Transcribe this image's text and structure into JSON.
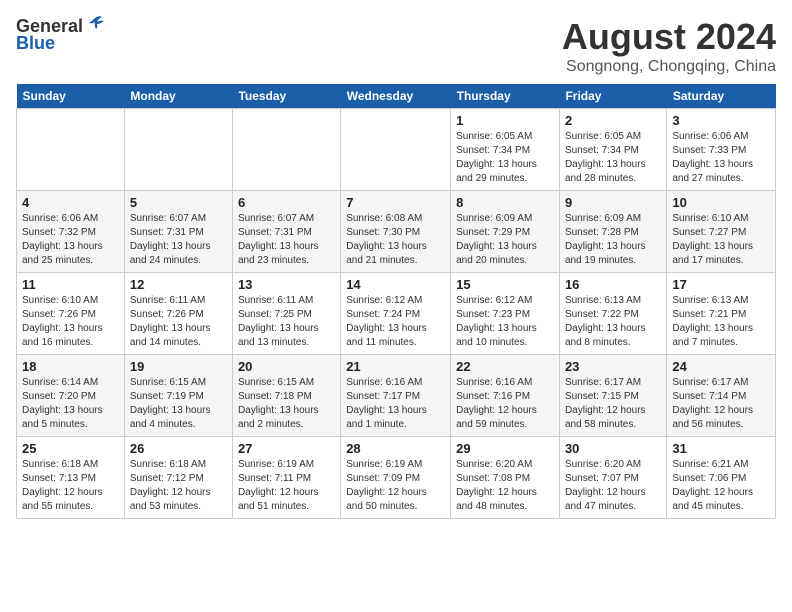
{
  "header": {
    "logo_general": "General",
    "logo_blue": "Blue",
    "month_year": "August 2024",
    "location": "Songnong, Chongqing, China"
  },
  "days_of_week": [
    "Sunday",
    "Monday",
    "Tuesday",
    "Wednesday",
    "Thursday",
    "Friday",
    "Saturday"
  ],
  "weeks": [
    [
      {
        "day": "",
        "info": ""
      },
      {
        "day": "",
        "info": ""
      },
      {
        "day": "",
        "info": ""
      },
      {
        "day": "",
        "info": ""
      },
      {
        "day": "1",
        "info": "Sunrise: 6:05 AM\nSunset: 7:34 PM\nDaylight: 13 hours\nand 29 minutes."
      },
      {
        "day": "2",
        "info": "Sunrise: 6:05 AM\nSunset: 7:34 PM\nDaylight: 13 hours\nand 28 minutes."
      },
      {
        "day": "3",
        "info": "Sunrise: 6:06 AM\nSunset: 7:33 PM\nDaylight: 13 hours\nand 27 minutes."
      }
    ],
    [
      {
        "day": "4",
        "info": "Sunrise: 6:06 AM\nSunset: 7:32 PM\nDaylight: 13 hours\nand 25 minutes."
      },
      {
        "day": "5",
        "info": "Sunrise: 6:07 AM\nSunset: 7:31 PM\nDaylight: 13 hours\nand 24 minutes."
      },
      {
        "day": "6",
        "info": "Sunrise: 6:07 AM\nSunset: 7:31 PM\nDaylight: 13 hours\nand 23 minutes."
      },
      {
        "day": "7",
        "info": "Sunrise: 6:08 AM\nSunset: 7:30 PM\nDaylight: 13 hours\nand 21 minutes."
      },
      {
        "day": "8",
        "info": "Sunrise: 6:09 AM\nSunset: 7:29 PM\nDaylight: 13 hours\nand 20 minutes."
      },
      {
        "day": "9",
        "info": "Sunrise: 6:09 AM\nSunset: 7:28 PM\nDaylight: 13 hours\nand 19 minutes."
      },
      {
        "day": "10",
        "info": "Sunrise: 6:10 AM\nSunset: 7:27 PM\nDaylight: 13 hours\nand 17 minutes."
      }
    ],
    [
      {
        "day": "11",
        "info": "Sunrise: 6:10 AM\nSunset: 7:26 PM\nDaylight: 13 hours\nand 16 minutes."
      },
      {
        "day": "12",
        "info": "Sunrise: 6:11 AM\nSunset: 7:26 PM\nDaylight: 13 hours\nand 14 minutes."
      },
      {
        "day": "13",
        "info": "Sunrise: 6:11 AM\nSunset: 7:25 PM\nDaylight: 13 hours\nand 13 minutes."
      },
      {
        "day": "14",
        "info": "Sunrise: 6:12 AM\nSunset: 7:24 PM\nDaylight: 13 hours\nand 11 minutes."
      },
      {
        "day": "15",
        "info": "Sunrise: 6:12 AM\nSunset: 7:23 PM\nDaylight: 13 hours\nand 10 minutes."
      },
      {
        "day": "16",
        "info": "Sunrise: 6:13 AM\nSunset: 7:22 PM\nDaylight: 13 hours\nand 8 minutes."
      },
      {
        "day": "17",
        "info": "Sunrise: 6:13 AM\nSunset: 7:21 PM\nDaylight: 13 hours\nand 7 minutes."
      }
    ],
    [
      {
        "day": "18",
        "info": "Sunrise: 6:14 AM\nSunset: 7:20 PM\nDaylight: 13 hours\nand 5 minutes."
      },
      {
        "day": "19",
        "info": "Sunrise: 6:15 AM\nSunset: 7:19 PM\nDaylight: 13 hours\nand 4 minutes."
      },
      {
        "day": "20",
        "info": "Sunrise: 6:15 AM\nSunset: 7:18 PM\nDaylight: 13 hours\nand 2 minutes."
      },
      {
        "day": "21",
        "info": "Sunrise: 6:16 AM\nSunset: 7:17 PM\nDaylight: 13 hours\nand 1 minute."
      },
      {
        "day": "22",
        "info": "Sunrise: 6:16 AM\nSunset: 7:16 PM\nDaylight: 12 hours\nand 59 minutes."
      },
      {
        "day": "23",
        "info": "Sunrise: 6:17 AM\nSunset: 7:15 PM\nDaylight: 12 hours\nand 58 minutes."
      },
      {
        "day": "24",
        "info": "Sunrise: 6:17 AM\nSunset: 7:14 PM\nDaylight: 12 hours\nand 56 minutes."
      }
    ],
    [
      {
        "day": "25",
        "info": "Sunrise: 6:18 AM\nSunset: 7:13 PM\nDaylight: 12 hours\nand 55 minutes."
      },
      {
        "day": "26",
        "info": "Sunrise: 6:18 AM\nSunset: 7:12 PM\nDaylight: 12 hours\nand 53 minutes."
      },
      {
        "day": "27",
        "info": "Sunrise: 6:19 AM\nSunset: 7:11 PM\nDaylight: 12 hours\nand 51 minutes."
      },
      {
        "day": "28",
        "info": "Sunrise: 6:19 AM\nSunset: 7:09 PM\nDaylight: 12 hours\nand 50 minutes."
      },
      {
        "day": "29",
        "info": "Sunrise: 6:20 AM\nSunset: 7:08 PM\nDaylight: 12 hours\nand 48 minutes."
      },
      {
        "day": "30",
        "info": "Sunrise: 6:20 AM\nSunset: 7:07 PM\nDaylight: 12 hours\nand 47 minutes."
      },
      {
        "day": "31",
        "info": "Sunrise: 6:21 AM\nSunset: 7:06 PM\nDaylight: 12 hours\nand 45 minutes."
      }
    ]
  ]
}
